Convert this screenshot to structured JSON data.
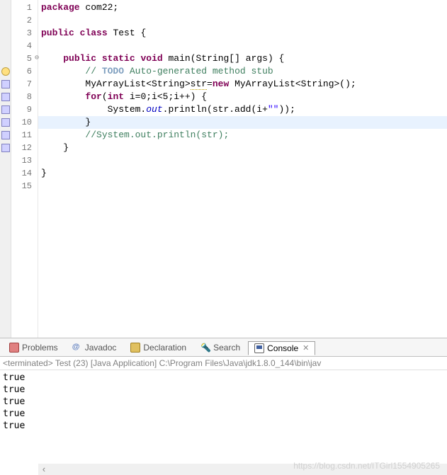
{
  "editor": {
    "lines": [
      {
        "n": "1",
        "marker": "",
        "tokens": [
          {
            "c": "kw",
            "t": "package"
          },
          {
            "c": "norm",
            "t": " com22;"
          }
        ]
      },
      {
        "n": "2",
        "marker": "",
        "tokens": []
      },
      {
        "n": "3",
        "marker": "",
        "tokens": [
          {
            "c": "kw",
            "t": "public"
          },
          {
            "c": "norm",
            "t": " "
          },
          {
            "c": "kw",
            "t": "class"
          },
          {
            "c": "norm",
            "t": " Test {"
          }
        ]
      },
      {
        "n": "4",
        "marker": "",
        "tokens": []
      },
      {
        "n": "5",
        "marker": "folded",
        "tokens": [
          {
            "c": "norm",
            "t": "    "
          },
          {
            "c": "kw",
            "t": "public"
          },
          {
            "c": "norm",
            "t": " "
          },
          {
            "c": "kw",
            "t": "static"
          },
          {
            "c": "norm",
            "t": " "
          },
          {
            "c": "kw",
            "t": "void"
          },
          {
            "c": "norm",
            "t": " main(String[] "
          },
          {
            "c": "norm",
            "t": "args"
          },
          {
            "c": "norm",
            "t": ") {"
          }
        ]
      },
      {
        "n": "6",
        "marker": "bulb",
        "tokens": [
          {
            "c": "norm",
            "t": "        "
          },
          {
            "c": "com",
            "t": "// "
          },
          {
            "c": "todo",
            "t": "TODO"
          },
          {
            "c": "com",
            "t": " Auto-generated method stub"
          }
        ]
      },
      {
        "n": "7",
        "marker": "blue",
        "tokens": [
          {
            "c": "norm",
            "t": "        MyArrayList<String>"
          },
          {
            "c": "warn",
            "t": "str"
          },
          {
            "c": "norm",
            "t": "="
          },
          {
            "c": "kw",
            "t": "new"
          },
          {
            "c": "norm",
            "t": " MyArrayList<String>();"
          }
        ]
      },
      {
        "n": "8",
        "marker": "blue",
        "tokens": [
          {
            "c": "norm",
            "t": "        "
          },
          {
            "c": "kw",
            "t": "for"
          },
          {
            "c": "norm",
            "t": "("
          },
          {
            "c": "kw",
            "t": "int"
          },
          {
            "c": "norm",
            "t": " i=0;i<5;i++) {"
          }
        ]
      },
      {
        "n": "9",
        "marker": "blue",
        "tokens": [
          {
            "c": "norm",
            "t": "            System."
          },
          {
            "c": "field",
            "t": "out"
          },
          {
            "c": "norm",
            "t": ".println(str.add(i+"
          },
          {
            "c": "str",
            "t": "\"\""
          },
          {
            "c": "norm",
            "t": "));"
          }
        ]
      },
      {
        "n": "10",
        "marker": "blue",
        "hl": true,
        "tokens": [
          {
            "c": "norm",
            "t": "        }"
          }
        ]
      },
      {
        "n": "11",
        "marker": "blue",
        "tokens": [
          {
            "c": "norm",
            "t": "        "
          },
          {
            "c": "com",
            "t": "//System.out.println("
          },
          {
            "c": "com",
            "t": "str"
          },
          {
            "c": "com",
            "t": ");"
          }
        ]
      },
      {
        "n": "12",
        "marker": "blue",
        "tokens": [
          {
            "c": "norm",
            "t": "    }"
          }
        ]
      },
      {
        "n": "13",
        "marker": "",
        "tokens": []
      },
      {
        "n": "14",
        "marker": "",
        "tokens": [
          {
            "c": "norm",
            "t": "}"
          }
        ]
      },
      {
        "n": "15",
        "marker": "",
        "tokens": []
      }
    ]
  },
  "tabs": {
    "problems": "Problems",
    "javadoc": "Javadoc",
    "declaration": "Declaration",
    "search": "Search",
    "console": "Console"
  },
  "console": {
    "header": "<terminated> Test (23) [Java Application] C:\\Program Files\\Java\\jdk1.8.0_144\\bin\\jav",
    "output": [
      "true",
      "true",
      "true",
      "true",
      "true"
    ]
  },
  "watermark": "https://blog.csdn.net/ITGirl1554905265"
}
